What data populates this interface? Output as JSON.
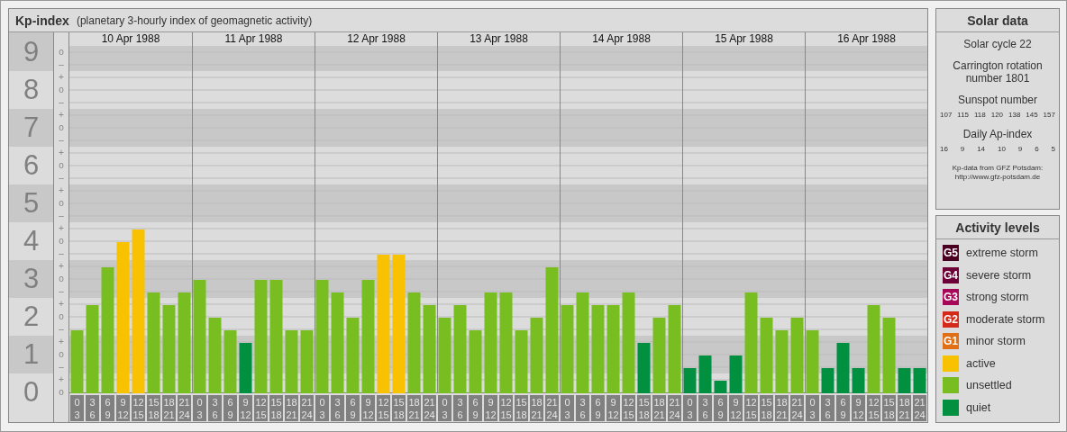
{
  "header": {
    "title": "Kp-index",
    "subtitle": "(planetary 3-hourly index of geomagnetic activity)"
  },
  "chart": {
    "days": [
      "10 Apr 1988",
      "11 Apr 1988",
      "12 Apr 1988",
      "13 Apr 1988",
      "14 Apr 1988",
      "15 Apr 1988",
      "16 Apr 1988"
    ],
    "minor_tick_labels": [
      "o",
      "–",
      "+",
      "o",
      "–",
      "+",
      "o",
      "–",
      "+",
      "o",
      "–",
      "+",
      "o",
      "–",
      "+",
      "o",
      "–",
      "+",
      "o",
      "–",
      "+",
      "o",
      "–",
      "+",
      "o",
      "–",
      "+",
      "o"
    ],
    "chart_data": {
      "type": "bar",
      "grid": true,
      "ylim": [
        0,
        9
      ],
      "yticks": [
        {
          "value": 9,
          "label": "9"
        },
        {
          "value": 8,
          "label": "8"
        },
        {
          "value": 7,
          "label": "7"
        },
        {
          "value": 6,
          "label": "6"
        },
        {
          "value": 5,
          "label": "5"
        },
        {
          "value": 4,
          "label": "4"
        },
        {
          "value": 3,
          "label": "3"
        },
        {
          "value": 2,
          "label": "2"
        },
        {
          "value": 1,
          "label": "1"
        },
        {
          "value": 0,
          "label": "0"
        }
      ],
      "categories": [
        "0 3",
        "3 6",
        "6 9",
        "9 12",
        "12 15",
        "15 18",
        "18 21",
        "21 24",
        "0 3",
        "3 6",
        "6 9",
        "9 12",
        "12 15",
        "15 18",
        "18 21",
        "21 24",
        "0 3",
        "3 6",
        "6 9",
        "9 12",
        "12 15",
        "15 18",
        "18 21",
        "21 24",
        "0 3",
        "3 6",
        "6 9",
        "9 12",
        "12 15",
        "15 18",
        "18 21",
        "21 24",
        "0 3",
        "3 6",
        "6 9",
        "9 12",
        "12 15",
        "15 18",
        "18 21",
        "21 24",
        "0 3",
        "3 6",
        "6 9",
        "9 12",
        "12 15",
        "15 18",
        "18 21",
        "21 24",
        "0 3",
        "3 6",
        "6 9",
        "9 12",
        "12 15",
        "15 18",
        "18 21",
        "21 24"
      ],
      "series": [
        {
          "color": "#009040",
          "values": [
            null,
            null,
            null,
            null,
            null,
            null,
            null,
            null,
            null,
            null,
            null,
            1.33,
            null,
            null,
            null,
            null,
            null,
            null,
            null,
            null,
            null,
            null,
            null,
            null,
            null,
            null,
            null,
            null,
            null,
            null,
            null,
            null,
            null,
            null,
            null,
            null,
            null,
            1.33,
            null,
            null,
            0.67,
            1,
            0.33,
            1,
            null,
            null,
            null,
            null,
            null,
            0.67,
            1.33,
            0.67,
            null,
            null,
            0.67,
            0.67
          ]
        },
        {
          "color": "#78be20",
          "values": [
            1.67,
            2.33,
            3.33,
            null,
            null,
            2.67,
            2.33,
            2.67,
            3,
            2,
            1.67,
            null,
            3,
            3,
            1.67,
            1.67,
            3,
            2.67,
            2,
            3,
            null,
            null,
            2.67,
            2.33,
            2,
            2.33,
            1.67,
            2.67,
            2.67,
            1.67,
            2,
            3.33,
            2.33,
            2.67,
            2.33,
            2.33,
            2.67,
            null,
            2,
            2.33,
            null,
            null,
            null,
            null,
            2.67,
            2,
            1.67,
            2,
            1.67,
            null,
            null,
            null,
            2.33,
            2,
            null,
            null
          ]
        },
        {
          "color": "#f8c200",
          "values": [
            null,
            null,
            null,
            4,
            4.33,
            null,
            null,
            null,
            null,
            null,
            null,
            null,
            null,
            null,
            null,
            null,
            null,
            null,
            null,
            null,
            3.67,
            3.67,
            null,
            null,
            null,
            null,
            null,
            null,
            null,
            null,
            null,
            null,
            null,
            null,
            null,
            null,
            null,
            null,
            null,
            null,
            null,
            null,
            null,
            null,
            null,
            null,
            null,
            null,
            null,
            null,
            null,
            null,
            null,
            null,
            null,
            null
          ]
        }
      ]
    }
  },
  "solar_data": {
    "title": "Solar data",
    "solar_cycle": "Solar cycle 22",
    "carrington": "Carrington rotation number 1801",
    "sunspot_title": "Sunspot number",
    "sunspot_numbers": [
      "107",
      "115",
      "118",
      "120",
      "138",
      "145",
      "157"
    ],
    "ap_title": "Daily Ap-index",
    "ap_values": [
      "16",
      "9",
      "14",
      "10",
      "9",
      "6",
      "5"
    ],
    "credit": [
      "Kp-data from GFZ Potsdam:",
      "http://www.gfz-potsdam.de"
    ]
  },
  "activity_levels": {
    "title": "Activity levels",
    "items": [
      {
        "badge": "G5",
        "label": "extreme storm",
        "color": "#4a0020"
      },
      {
        "badge": "G4",
        "label": "severe storm",
        "color": "#6e0038"
      },
      {
        "badge": "G3",
        "label": "strong storm",
        "color": "#a8085a"
      },
      {
        "badge": "G2",
        "label": "moderate storm",
        "color": "#d42a1a"
      },
      {
        "badge": "G1",
        "label": "minor storm",
        "color": "#e07018"
      },
      {
        "label": "active",
        "color": "#f8c200"
      },
      {
        "label": "unsettled",
        "color": "#78be20"
      },
      {
        "label": "quiet",
        "color": "#009040"
      }
    ]
  }
}
